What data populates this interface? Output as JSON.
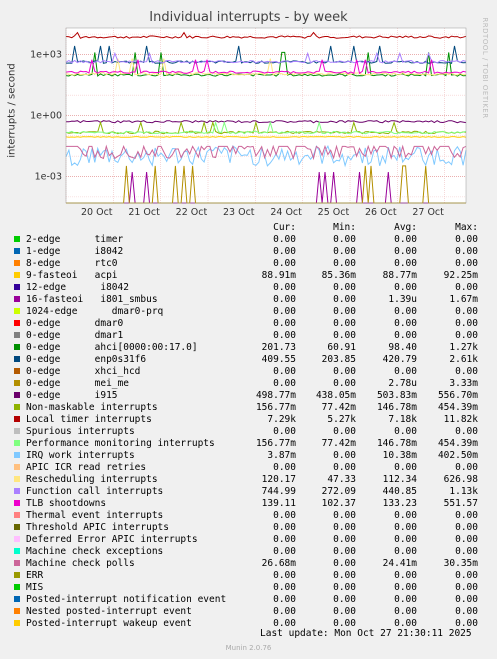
{
  "title": "Individual interrupts - by week",
  "side_label": "RRDTOOL / TOBI OETIKER",
  "footer": "Munin 2.0.76",
  "last_update": "Last update: Mon Oct 27 21:30:11 2025",
  "legend_headers": [
    "Cur:",
    "Min:",
    "Avg:",
    "Max:"
  ],
  "chart_data": {
    "type": "line",
    "title": "Individual interrupts - by week",
    "xlabel": "",
    "ylabel": "interrupts / second",
    "yscale": "log",
    "ylim": [
      5e-05,
      20000
    ],
    "y_ticks": [
      {
        "label": "1e+03",
        "value": 1000
      },
      {
        "label": "1e+00",
        "value": 1
      },
      {
        "label": "1e-03",
        "value": 0.001
      }
    ],
    "x_ticks": [
      "20 Oct",
      "21 Oct",
      "22 Oct",
      "23 Oct",
      "24 Oct",
      "25 Oct",
      "26 Oct",
      "27 Oct"
    ],
    "grid": true,
    "series": [
      {
        "name": "2-edge      timer",
        "color": "#00cc00",
        "cur": "0.00",
        "min": "0.00",
        "avg": "0.00",
        "max": "0.00"
      },
      {
        "name": "1-edge      i8042",
        "color": "#0066b3",
        "cur": "0.00",
        "min": "0.00",
        "avg": "0.00",
        "max": "0.00"
      },
      {
        "name": "8-edge      rtc0",
        "color": "#ff8000",
        "cur": "0.00",
        "min": "0.00",
        "avg": "0.00",
        "max": "0.00"
      },
      {
        "name": "9-fasteoi   acpi",
        "color": "#ffcc00",
        "cur": "88.91m",
        "min": "85.36m",
        "avg": "88.77m",
        "max": "92.25m"
      },
      {
        "name": "12-edge      i8042",
        "color": "#330099",
        "cur": "0.00",
        "min": "0.00",
        "avg": "0.00",
        "max": "0.00"
      },
      {
        "name": "16-fasteoi   i801_smbus",
        "color": "#990099",
        "cur": "0.00",
        "min": "0.00",
        "avg": "1.39u",
        "max": "1.67m"
      },
      {
        "name": "1024-edge      dmar0-prq",
        "color": "#ccff00",
        "cur": "0.00",
        "min": "0.00",
        "avg": "0.00",
        "max": "0.00"
      },
      {
        "name": "0-edge      dmar0",
        "color": "#ff0000",
        "cur": "0.00",
        "min": "0.00",
        "avg": "0.00",
        "max": "0.00"
      },
      {
        "name": "0-edge      dmar1",
        "color": "#808080",
        "cur": "0.00",
        "min": "0.00",
        "avg": "0.00",
        "max": "0.00"
      },
      {
        "name": "0-edge      ahci[0000:00:17.0]",
        "color": "#008f00",
        "cur": "201.73",
        "min": "60.91",
        "avg": "98.40",
        "max": "1.27k"
      },
      {
        "name": "0-edge      enp0s31f6",
        "color": "#00487d",
        "cur": "409.55",
        "min": "203.85",
        "avg": "420.79",
        "max": "2.61k"
      },
      {
        "name": "0-edge      xhci_hcd",
        "color": "#b35a00",
        "cur": "0.00",
        "min": "0.00",
        "avg": "0.00",
        "max": "0.00"
      },
      {
        "name": "0-edge      mei_me",
        "color": "#b38f00",
        "cur": "0.00",
        "min": "0.00",
        "avg": "2.78u",
        "max": "3.33m"
      },
      {
        "name": "0-edge      i915",
        "color": "#6b006b",
        "cur": "498.77m",
        "min": "438.05m",
        "avg": "503.83m",
        "max": "556.70m"
      },
      {
        "name": "Non-maskable interrupts",
        "color": "#8fb300",
        "cur": "156.77m",
        "min": "77.42m",
        "avg": "146.78m",
        "max": "454.39m"
      },
      {
        "name": "Local timer interrupts",
        "color": "#b30000",
        "cur": "7.29k",
        "min": "5.27k",
        "avg": "7.18k",
        "max": "11.82k"
      },
      {
        "name": "Spurious interrupts",
        "color": "#bebebe",
        "cur": "0.00",
        "min": "0.00",
        "avg": "0.00",
        "max": "0.00"
      },
      {
        "name": "Performance monitoring interrupts",
        "color": "#80ff80",
        "cur": "156.77m",
        "min": "77.42m",
        "avg": "146.78m",
        "max": "454.39m"
      },
      {
        "name": "IRQ work interrupts",
        "color": "#80c9ff",
        "cur": "3.87m",
        "min": "0.00",
        "avg": "10.38m",
        "max": "402.50m"
      },
      {
        "name": "APIC ICR read retries",
        "color": "#ffc080",
        "cur": "0.00",
        "min": "0.00",
        "avg": "0.00",
        "max": "0.00"
      },
      {
        "name": "Rescheduling interrupts",
        "color": "#ffe680",
        "cur": "120.17",
        "min": "47.33",
        "avg": "112.34",
        "max": "626.98"
      },
      {
        "name": "Function call interrupts",
        "color": "#aa80ff",
        "cur": "744.99",
        "min": "272.09",
        "avg": "440.85",
        "max": "1.13k"
      },
      {
        "name": "TLB shootdowns",
        "color": "#ee00cc",
        "cur": "139.11",
        "min": "102.37",
        "avg": "133.23",
        "max": "551.57"
      },
      {
        "name": "Thermal event interrupts",
        "color": "#ff8080",
        "cur": "0.00",
        "min": "0.00",
        "avg": "0.00",
        "max": "0.00"
      },
      {
        "name": "Threshold APIC interrupts",
        "color": "#666600",
        "cur": "0.00",
        "min": "0.00",
        "avg": "0.00",
        "max": "0.00"
      },
      {
        "name": "Deferred Error APIC interrupts",
        "color": "#ffbfff",
        "cur": "0.00",
        "min": "0.00",
        "avg": "0.00",
        "max": "0.00"
      },
      {
        "name": "Machine check exceptions",
        "color": "#00ffcc",
        "cur": "0.00",
        "min": "0.00",
        "avg": "0.00",
        "max": "0.00"
      },
      {
        "name": "Machine check polls",
        "color": "#cc6699",
        "cur": "26.68m",
        "min": "0.00",
        "avg": "24.41m",
        "max": "30.35m"
      },
      {
        "name": "ERR",
        "color": "#999900",
        "cur": "0.00",
        "min": "0.00",
        "avg": "0.00",
        "max": "0.00"
      },
      {
        "name": "MIS",
        "color": "#00cc00",
        "cur": "0.00",
        "min": "0.00",
        "avg": "0.00",
        "max": "0.00"
      },
      {
        "name": "Posted-interrupt notification event",
        "color": "#0066b3",
        "cur": "0.00",
        "min": "0.00",
        "avg": "0.00",
        "max": "0.00"
      },
      {
        "name": "Nested posted-interrupt event",
        "color": "#ff8000",
        "cur": "0.00",
        "min": "0.00",
        "avg": "0.00",
        "max": "0.00"
      },
      {
        "name": "Posted-interrupt wakeup event",
        "color": "#ffcc00",
        "cur": "0.00",
        "min": "0.00",
        "avg": "0.00",
        "max": "0.00"
      }
    ]
  }
}
